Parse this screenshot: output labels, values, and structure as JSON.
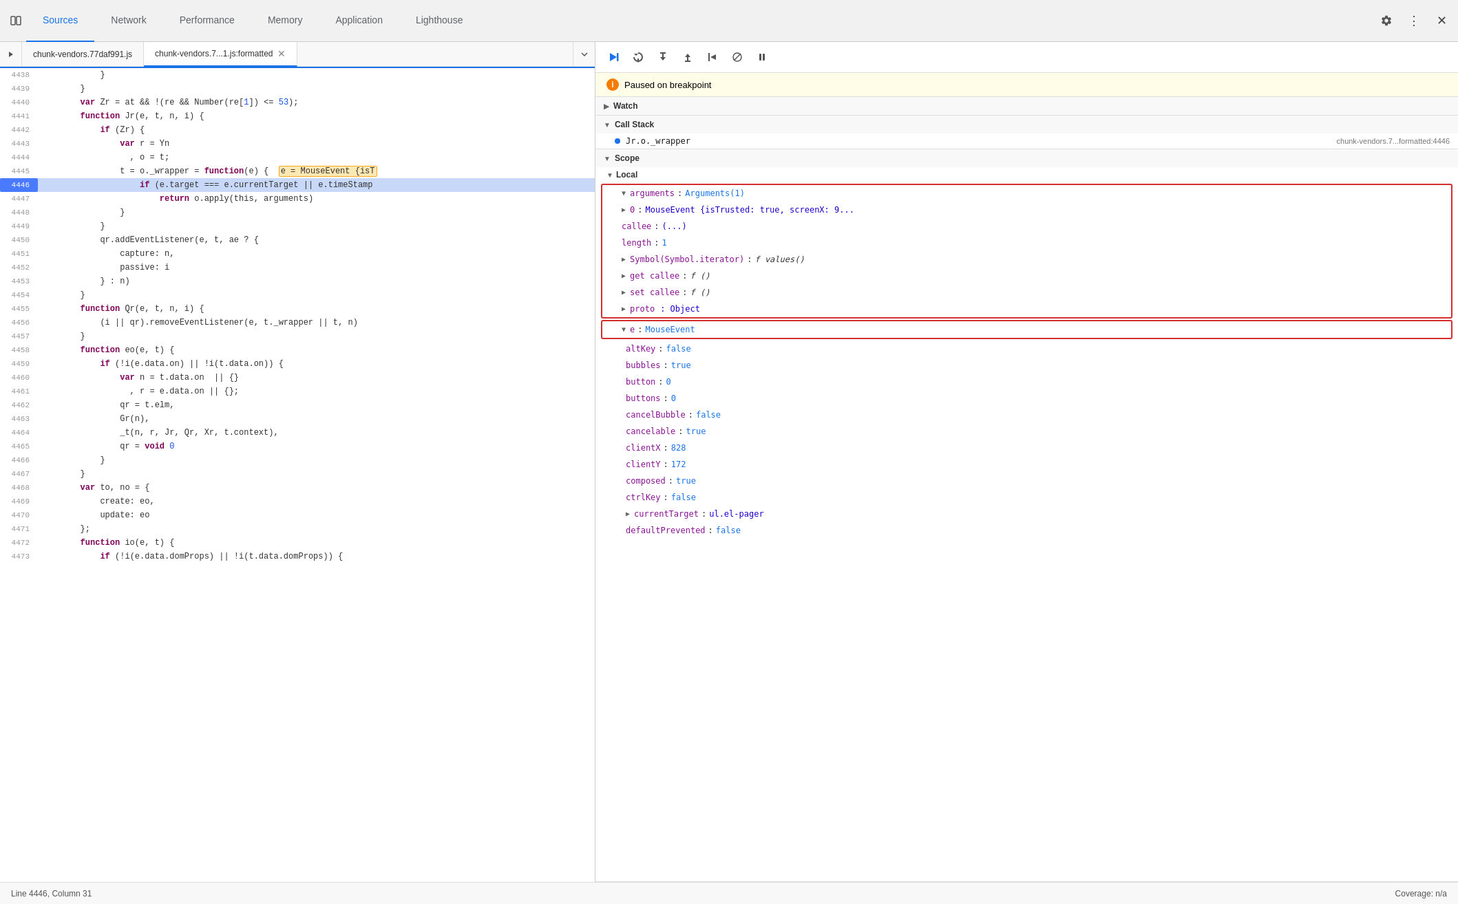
{
  "tabs": [
    {
      "label": "Sources",
      "active": true
    },
    {
      "label": "Network",
      "active": false
    },
    {
      "label": "Performance",
      "active": false
    },
    {
      "label": "Memory",
      "active": false
    },
    {
      "label": "Application",
      "active": false
    },
    {
      "label": "Lighthouse",
      "active": false
    }
  ],
  "file_tabs": [
    {
      "label": "chunk-vendors.77daf991.js",
      "active": false,
      "closeable": false
    },
    {
      "label": "chunk-vendors.7...1.js:formatted",
      "active": true,
      "closeable": true
    }
  ],
  "paused_message": "Paused on breakpoint",
  "watch_label": "Watch",
  "call_stack_label": "Call Stack",
  "scope_label": "Scope",
  "local_label": "Local",
  "call_stack_items": [
    {
      "fn": "Jr.o._wrapper",
      "file": "chunk-vendors.7...formatted:4446"
    }
  ],
  "code_lines": [
    {
      "num": 4438,
      "content": "            }",
      "highlighted": false
    },
    {
      "num": 4439,
      "content": "        }",
      "highlighted": false
    },
    {
      "num": 4440,
      "content": "        var Zr = at && !(re && Number(re[1]) <= 53);",
      "highlighted": false
    },
    {
      "num": 4441,
      "content": "        function Jr(e, t, n, i) {",
      "highlighted": false
    },
    {
      "num": 4442,
      "content": "            if (Zr) {",
      "highlighted": false
    },
    {
      "num": 4443,
      "content": "                var r = Yn",
      "highlighted": false
    },
    {
      "num": 4444,
      "content": "                  , o = t;",
      "highlighted": false
    },
    {
      "num": 4445,
      "content": "                t = o._wrapper = function(e) {  e = MouseEvent {isT",
      "highlighted": false
    },
    {
      "num": 4446,
      "content": "                    if (e.target === e.currentTarget || e.timeStamp",
      "highlighted": true
    },
    {
      "num": 4447,
      "content": "                        return o.apply(this, arguments)",
      "highlighted": false
    },
    {
      "num": 4448,
      "content": "                }",
      "highlighted": false
    },
    {
      "num": 4449,
      "content": "            }",
      "highlighted": false
    },
    {
      "num": 4450,
      "content": "            qr.addEventListener(e, t, ae ? {",
      "highlighted": false
    },
    {
      "num": 4451,
      "content": "                capture: n,",
      "highlighted": false
    },
    {
      "num": 4452,
      "content": "                passive: i",
      "highlighted": false
    },
    {
      "num": 4453,
      "content": "            } : n)",
      "highlighted": false
    },
    {
      "num": 4454,
      "content": "        }",
      "highlighted": false
    },
    {
      "num": 4455,
      "content": "        function Qr(e, t, n, i) {",
      "highlighted": false
    },
    {
      "num": 4456,
      "content": "            (i || qr).removeEventListener(e, t._wrapper || t, n)",
      "highlighted": false
    },
    {
      "num": 4457,
      "content": "        }",
      "highlighted": false
    },
    {
      "num": 4458,
      "content": "        function eo(e, t) {",
      "highlighted": false
    },
    {
      "num": 4459,
      "content": "            if (!i(e.data.on) || !i(t.data.on)) {",
      "highlighted": false
    },
    {
      "num": 4460,
      "content": "                var n = t.data.on  || {}",
      "highlighted": false
    },
    {
      "num": 4461,
      "content": "                  , r = e.data.on || {};",
      "highlighted": false
    },
    {
      "num": 4462,
      "content": "                qr = t.elm,",
      "highlighted": false
    },
    {
      "num": 4463,
      "content": "                Gr(n),",
      "highlighted": false
    },
    {
      "num": 4464,
      "content": "                _t(n, r, Jr, Qr, Xr, t.context),",
      "highlighted": false
    },
    {
      "num": 4465,
      "content": "                qr = void 0",
      "highlighted": false
    },
    {
      "num": 4466,
      "content": "            }",
      "highlighted": false
    },
    {
      "num": 4467,
      "content": "        }",
      "highlighted": false
    },
    {
      "num": 4468,
      "content": "        var to, no = {",
      "highlighted": false
    },
    {
      "num": 4469,
      "content": "            create: eo,",
      "highlighted": false
    },
    {
      "num": 4470,
      "content": "            update: eo",
      "highlighted": false
    },
    {
      "num": 4471,
      "content": "        };",
      "highlighted": false
    },
    {
      "num": 4472,
      "content": "        function io(e, t) {",
      "highlighted": false
    },
    {
      "num": 4473,
      "content": "            if (!i(e.data.domProps) || !i(t.data.domProps)) {",
      "highlighted": false
    }
  ],
  "scope_arguments": {
    "label": "arguments",
    "type": "Arguments(1)",
    "children": [
      {
        "key": "0",
        "val": "MouseEvent {isTrusted: true, screenX: 9..."
      },
      {
        "key": "callee",
        "val": "(...)"
      },
      {
        "key": "length",
        "val": "1"
      },
      {
        "key": "Symbol(Symbol.iterator)",
        "val": "f values()"
      },
      {
        "key": "get callee",
        "val": "f ()"
      },
      {
        "key": "set callee",
        "val": "f ()"
      },
      {
        "key": "proto",
        "val": ": Object"
      }
    ]
  },
  "scope_e": {
    "label": "e",
    "type": "MouseEvent",
    "children": [
      {
        "key": "altKey",
        "val": "false"
      },
      {
        "key": "bubbles",
        "val": "true"
      },
      {
        "key": "button",
        "val": "0"
      },
      {
        "key": "buttons",
        "val": "0"
      },
      {
        "key": "cancelBubble",
        "val": "false"
      },
      {
        "key": "cancelable",
        "val": "true"
      },
      {
        "key": "clientX",
        "val": "828"
      },
      {
        "key": "clientY",
        "val": "172"
      },
      {
        "key": "composed",
        "val": "true"
      },
      {
        "key": "ctrlKey",
        "val": "false"
      },
      {
        "key": "currentTarget",
        "val": "ul.el-pager"
      },
      {
        "key": "defaultPrevented",
        "val": "false"
      }
    ]
  },
  "status_line": "Line 4446, Column 31",
  "status_coverage": "Coverage: n/a"
}
